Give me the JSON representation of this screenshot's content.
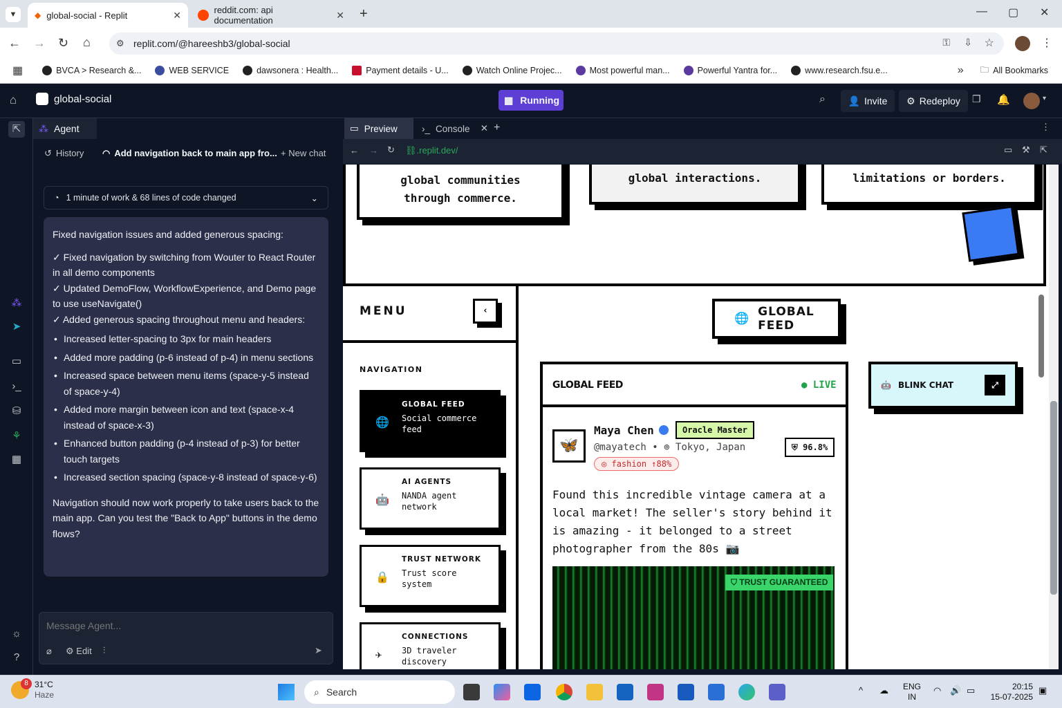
{
  "browser": {
    "tabs": [
      {
        "title": "global-social - Replit",
        "active": true
      },
      {
        "title": "reddit.com: api documentation",
        "active": false
      }
    ],
    "url": "replit.com/@hareeshb3/global-social",
    "bookmarks": [
      "BVCA > Research &...",
      "WEB SERVICE",
      "dawsonera : Health...",
      "Payment details - U...",
      "Watch Online Projec...",
      "Most powerful man...",
      "Powerful Yantra for...",
      "www.research.fsu.e..."
    ],
    "all_bookmarks": "All Bookmarks"
  },
  "app": {
    "repl_name": "global-social",
    "run_status": "Running",
    "invite": "Invite",
    "redeploy": "Redeploy"
  },
  "agent": {
    "tab_label": "Agent",
    "history": "History",
    "chat_title": "Add navigation back to main app fro...",
    "new_chat": "New chat",
    "work_summary": "1 minute of work & 68 lines of code changed",
    "message": {
      "intro": "Fixed navigation issues and added generous spacing:",
      "checks": [
        "✓ Fixed navigation by switching from Wouter to React Router in all demo components",
        "✓ Updated DemoFlow, WorkflowExperience, and Demo page to use useNavigate()",
        "✓ Added generous spacing throughout menu and headers:"
      ],
      "bullets": [
        "Increased letter-spacing to 3px for main headers",
        "Added more padding (p-6 instead of p-4) in menu sections",
        "Increased space between menu items (space-y-5 instead of space-y-4)",
        "Added more margin between icon and text (space-x-4 instead of space-x-3)",
        "Enhanced button padding (p-4 instead of p-3) for better touch targets",
        "Increased section spacing (space-y-8 instead of space-y-6)"
      ],
      "outro": "Navigation should now work properly to take users back to the main app. Can you test the \"Back to App\" buttons in the demo flows?"
    },
    "input_placeholder": "Message Agent...",
    "edit_label": "Edit"
  },
  "preview": {
    "tabs": [
      "Preview",
      "Console"
    ],
    "url": ".replit.dev/",
    "top_cards": [
      "global communities through commerce.",
      "global interactions.",
      "limitations or borders."
    ],
    "menu_title": "MENU",
    "nav_heading": "NAVIGATION",
    "menu_items": [
      {
        "title": "GLOBAL FEED",
        "sub": "Social commerce feed",
        "icon": "globe-icon",
        "active": true
      },
      {
        "title": "AI AGENTS",
        "sub": "NANDA agent network",
        "icon": "robot-icon",
        "active": false
      },
      {
        "title": "TRUST NETWORK",
        "sub": "Trust score system",
        "icon": "lock-icon",
        "active": false
      },
      {
        "title": "CONNECTIONS",
        "sub": "3D traveler discovery",
        "icon": "plane-icon",
        "active": false
      }
    ],
    "feed_badge": "GLOBAL FEED",
    "feed_header": "GLOBAL FEED",
    "live": "LIVE",
    "blink_chat": "BLINK CHAT",
    "post": {
      "name": "Maya Chen",
      "role": "Oracle Master",
      "handle": "@mayatech",
      "separator": "•",
      "location": "Tokyo, Japan",
      "trust": "96.8%",
      "tag": "fashion ↑88%",
      "text": "Found this incredible vintage camera at a local market! The seller's story behind it is amazing - it belonged to a street photographer from the 80s 📷",
      "image_badge": "TRUST GUARANTEED"
    }
  },
  "taskbar": {
    "weather_temp": "31°C",
    "weather_desc": "Haze",
    "weather_badge": "8",
    "search": "Search",
    "lang1": "ENG",
    "lang2": "IN",
    "time": "20:15",
    "date": "15-07-2025"
  }
}
